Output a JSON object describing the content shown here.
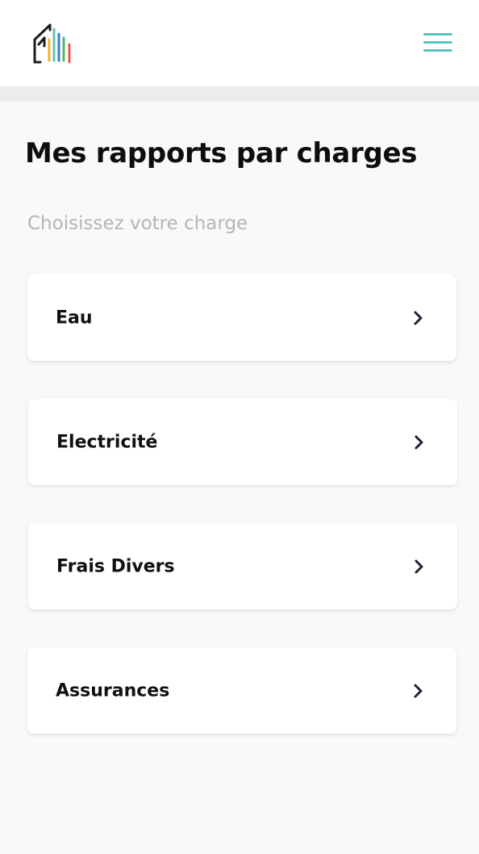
{
  "header": {
    "logo_icon": "house-bars-logo-icon",
    "menu_icon": "hamburger-menu-icon",
    "accent_color": "#5cc3bd"
  },
  "page": {
    "title": "Mes rapports par charges",
    "subtitle": "Choisissez votre charge"
  },
  "charges": [
    {
      "label": "Eau",
      "icon": "chevron-right-icon"
    },
    {
      "label": "Electricité",
      "icon": "chevron-right-icon"
    },
    {
      "label": "Frais Divers",
      "icon": "chevron-right-icon"
    },
    {
      "label": "Assurances",
      "icon": "chevron-right-icon"
    }
  ]
}
